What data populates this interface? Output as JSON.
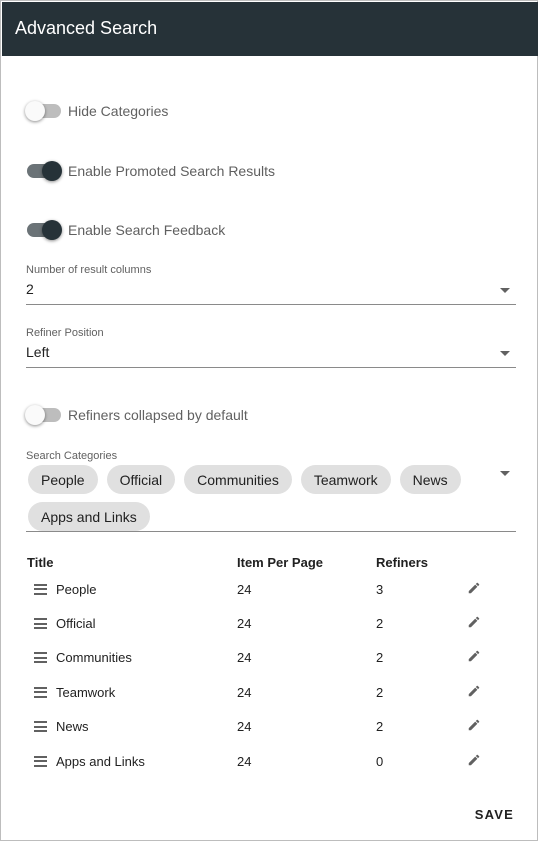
{
  "header": {
    "title": "Advanced Search"
  },
  "toggles": [
    {
      "label": "Hide Categories",
      "on": false
    },
    {
      "label": "Enable Promoted Search Results",
      "on": true
    },
    {
      "label": "Enable Search Feedback",
      "on": true
    },
    {
      "label": "Refiners collapsed by default",
      "on": false
    }
  ],
  "result_columns": {
    "label": "Number of result columns",
    "value": "2"
  },
  "refiner_position": {
    "label": "Refiner Position",
    "value": "Left"
  },
  "search_categories": {
    "label": "Search Categories",
    "chips": [
      "People",
      "Official",
      "Communities",
      "Teamwork",
      "News",
      "Apps and Links"
    ]
  },
  "table": {
    "headers": {
      "title": "Title",
      "items": "Item Per Page",
      "refiners": "Refiners"
    },
    "rows": [
      {
        "title": "People",
        "items": "24",
        "refiners": "3"
      },
      {
        "title": "Official",
        "items": "24",
        "refiners": "2"
      },
      {
        "title": "Communities",
        "items": "24",
        "refiners": "2"
      },
      {
        "title": "Teamwork",
        "items": "24",
        "refiners": "2"
      },
      {
        "title": "News",
        "items": "24",
        "refiners": "2"
      },
      {
        "title": "Apps and Links",
        "items": "24",
        "refiners": "0"
      }
    ]
  },
  "actions": {
    "save": "SAVE"
  },
  "icons": {
    "drag": "drag-handle-icon",
    "edit": "pencil-icon",
    "dropdown": "caret-down-icon"
  },
  "colors": {
    "header_bg": "#263238",
    "toggle_on": "#263238",
    "chip_bg": "#e0e0e0"
  }
}
